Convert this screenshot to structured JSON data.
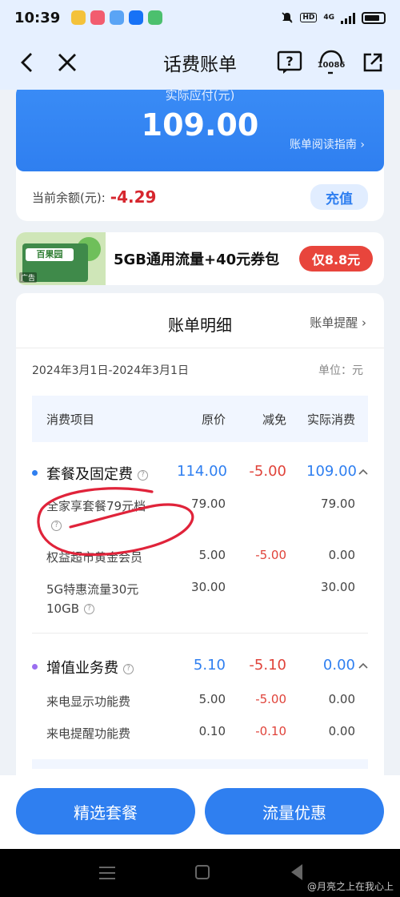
{
  "status": {
    "time": "10:39",
    "hd": "HD",
    "network": "4G"
  },
  "nav": {
    "title": "话费账单",
    "hotline": "10086"
  },
  "bill": {
    "due_label": "实际应付(元)",
    "due_amount": "109.00",
    "guide_link": "账单阅读指南 ›",
    "balance_label": "当前余额(元):",
    "balance_value": "-4.29",
    "recharge_label": "充值"
  },
  "promo": {
    "image_sign": "百果园",
    "ad_tag": "广告",
    "text": "5GB通用流量+40元券包",
    "button": "仅8.8元"
  },
  "detail": {
    "title": "账单明细",
    "reminder_link": "账单提醒 ›",
    "date_range": "2024年3月1日-2024年3月1日",
    "unit": "单位：元",
    "columns": [
      "消费项目",
      "原价",
      "减免",
      "实际消费"
    ],
    "groups": [
      {
        "name": "套餐及固定费",
        "original": "114.00",
        "discount": "-5.00",
        "actual": "109.00",
        "bullet_color": "#2f7ff0",
        "items": [
          {
            "name": "全家享套餐79元档",
            "original": "79.00",
            "discount": "",
            "actual": "79.00"
          },
          {
            "name": "权益超市黄金会员",
            "original": "5.00",
            "discount": "-5.00",
            "actual": "0.00"
          },
          {
            "name": "5G特惠流量30元",
            "name2": "10GB",
            "original": "30.00",
            "discount": "",
            "actual": "30.00"
          }
        ]
      },
      {
        "name": "增值业务费",
        "original": "5.10",
        "discount": "-5.10",
        "actual": "0.00",
        "bullet_color": "#9b6ef0",
        "items": [
          {
            "name": "来电显示功能费",
            "original": "5.00",
            "discount": "-5.00",
            "actual": "0.00"
          },
          {
            "name": "来电提醒功能费",
            "original": "0.10",
            "discount": "-0.10",
            "actual": "0.00"
          }
        ]
      }
    ]
  },
  "bottom": {
    "left_button": "精选套餐",
    "right_button": "流量优惠"
  },
  "watermark": "@月亮之上在我心上"
}
